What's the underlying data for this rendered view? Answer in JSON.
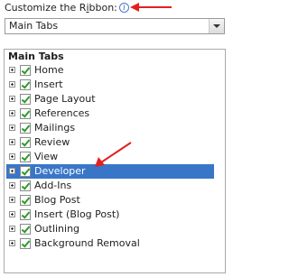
{
  "customize_label": {
    "prefix": "Customize the R",
    "underlined": "i",
    "suffix": "bbon:",
    "info_icon": "info-icon"
  },
  "tabs_combo": {
    "value": "Main Tabs"
  },
  "tree": {
    "header": "Main Tabs",
    "items": [
      {
        "label": "Home",
        "checked": true,
        "selected": false
      },
      {
        "label": "Insert",
        "checked": true,
        "selected": false
      },
      {
        "label": "Page Layout",
        "checked": true,
        "selected": false
      },
      {
        "label": "References",
        "checked": true,
        "selected": false
      },
      {
        "label": "Mailings",
        "checked": true,
        "selected": false
      },
      {
        "label": "Review",
        "checked": true,
        "selected": false
      },
      {
        "label": "View",
        "checked": true,
        "selected": false
      },
      {
        "label": "Developer",
        "checked": true,
        "selected": true
      },
      {
        "label": "Add-Ins",
        "checked": true,
        "selected": false
      },
      {
        "label": "Blog Post",
        "checked": true,
        "selected": false
      },
      {
        "label": "Insert (Blog Post)",
        "checked": true,
        "selected": false
      },
      {
        "label": "Outlining",
        "checked": true,
        "selected": false
      },
      {
        "label": "Background Removal",
        "checked": true,
        "selected": false
      }
    ]
  },
  "colors": {
    "selection": "#3a76c8",
    "annotation_arrow": "#e32020",
    "checkmark": "#2e9a2e"
  }
}
